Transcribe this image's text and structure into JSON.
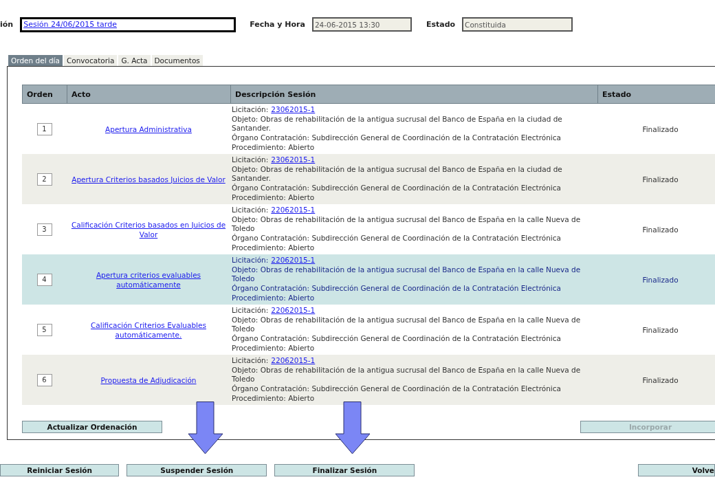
{
  "session": {
    "label": "ión",
    "value": "Sesión 24/06/2015 tarde"
  },
  "date": {
    "label": "Fecha y Hora",
    "value": "24-06-2015 13:30"
  },
  "status": {
    "label": "Estado",
    "value": "Constituida"
  },
  "tabs": [
    {
      "label": "Orden del día",
      "selected": true
    },
    {
      "label": "Convocatoria",
      "selected": false
    },
    {
      "label": "G. Acta",
      "selected": false
    },
    {
      "label": "Documentos",
      "selected": false
    }
  ],
  "table": {
    "columns": [
      "Orden",
      "Acto",
      "Descripción Sesión",
      "Estado"
    ],
    "rows": [
      {
        "order": "1",
        "act": "Apertura Administrativa",
        "licitacion_label": "Licitación:",
        "licitacion": "23062015-1",
        "objeto": "Objeto: Obras de rehabilitación de la antigua sucrusal del Banco de España en la ciudad de Santander.",
        "organo": "Órgano Contratación: Subdirección General de Coordinación de la Contratación Electrónica",
        "procedimiento": "Procedimiento: Abierto",
        "estado": "Finalizado",
        "selected": false
      },
      {
        "order": "2",
        "act": "Apertura Criterios basados Juicios de Valor",
        "licitacion_label": "Licitación:",
        "licitacion": "23062015-1",
        "objeto": "Objeto: Obras de rehabilitación de la antigua sucrusal del Banco de España en la ciudad de Santander.",
        "organo": "Órgano Contratación: Subdirección General de Coordinación de la Contratación Electrónica",
        "procedimiento": "Procedimiento: Abierto",
        "estado": "Finalizado",
        "selected": false
      },
      {
        "order": "3",
        "act": "Calificación Criterios basados en Juicios de Valor",
        "licitacion_label": "Licitación:",
        "licitacion": "22062015-1",
        "objeto": "Objeto: Obras de rehabilitación de la antigua sucrusal del Banco de España en la calle Nueva de Toledo",
        "organo": "Órgano Contratación: Subdirección General de Coordinación de la Contratación Electrónica",
        "procedimiento": "Procedimiento: Abierto",
        "estado": "Finalizado",
        "selected": false
      },
      {
        "order": "4",
        "act": "Apertura criterios evaluables automáticamente",
        "licitacion_label": "Licitación:",
        "licitacion": "22062015-1",
        "objeto": "Objeto: Obras de rehabilitación de la antigua sucrusal del Banco de España en la calle Nueva de Toledo",
        "organo": "Órgano Contratación: Subdirección General de Coordinación de la Contratación Electrónica",
        "procedimiento": "Procedimiento: Abierto",
        "estado": "Finalizado",
        "selected": true
      },
      {
        "order": "5",
        "act": "Calificación Criterios Evaluables automáticamente.",
        "licitacion_label": "Licitación:",
        "licitacion": "22062015-1",
        "objeto": "Objeto: Obras de rehabilitación de la antigua sucrusal del Banco de España en la calle Nueva de Toledo",
        "organo": "Órgano Contratación: Subdirección General de Coordinación de la Contratación Electrónica",
        "procedimiento": "Procedimiento: Abierto",
        "estado": "Finalizado",
        "selected": false
      },
      {
        "order": "6",
        "act": "Propuesta de Adjudicación",
        "licitacion_label": "Licitación:",
        "licitacion": "22062015-1",
        "objeto": "Objeto: Obras de rehabilitación de la antigua sucrusal del Banco de España en la calle Nueva de Toledo",
        "organo": "Órgano Contratación: Subdirección General de Coordinación de la Contratación Electrónica",
        "procedimiento": "Procedimiento: Abierto",
        "estado": "Finalizado",
        "selected": false
      }
    ]
  },
  "table_buttons": [
    {
      "label": "Actualizar Ordenación",
      "disabled": false
    },
    {
      "label": "Incorporar",
      "disabled": true
    }
  ],
  "footer_buttons": [
    {
      "label": "Reiniciar Sesión"
    },
    {
      "label": "Suspender Sesión"
    },
    {
      "label": "Finalizar Sesión"
    },
    {
      "label": "Volve"
    }
  ]
}
